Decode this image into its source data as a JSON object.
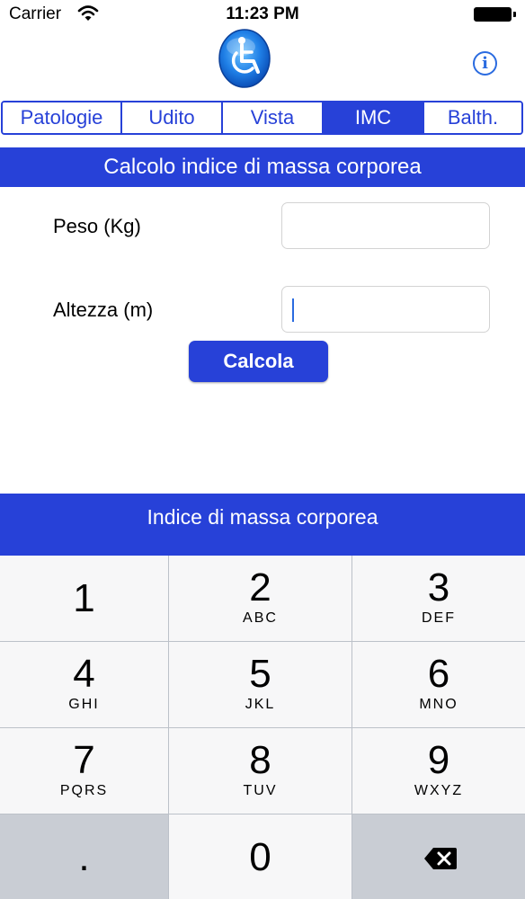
{
  "status_bar": {
    "carrier": "Carrier",
    "time": "11:23 PM"
  },
  "header": {
    "logo_icon": "wheelchair-accessibility-logo",
    "info_icon": "info-icon",
    "info_label": "i"
  },
  "tabs": [
    {
      "label": "Patologie",
      "selected": false
    },
    {
      "label": "Udito",
      "selected": false
    },
    {
      "label": "Vista",
      "selected": false
    },
    {
      "label": "IMC",
      "selected": true
    },
    {
      "label": "Balth.",
      "selected": false
    }
  ],
  "form": {
    "title": "Calcolo indice di massa corporea",
    "weight_label": "Peso (Kg)",
    "weight_value": "",
    "height_label": "Altezza (m)",
    "height_value": "",
    "submit_label": "Calcola"
  },
  "result": {
    "label": "Indice di massa corporea"
  },
  "keypad": {
    "keys": [
      {
        "digit": "1",
        "letters": ""
      },
      {
        "digit": "2",
        "letters": "ABC"
      },
      {
        "digit": "3",
        "letters": "DEF"
      },
      {
        "digit": "4",
        "letters": "GHI"
      },
      {
        "digit": "5",
        "letters": "JKL"
      },
      {
        "digit": "6",
        "letters": "MNO"
      },
      {
        "digit": "7",
        "letters": "PQRS"
      },
      {
        "digit": "8",
        "letters": "TUV"
      },
      {
        "digit": "9",
        "letters": "WXYZ"
      },
      {
        "digit": ".",
        "letters": ""
      },
      {
        "digit": "0",
        "letters": ""
      }
    ],
    "delete_icon": "backspace-icon"
  },
  "colors": {
    "accent": "#2741d8",
    "keypad_key": "#f7f7f8",
    "keypad_dark_key": "#c9cdd4"
  }
}
